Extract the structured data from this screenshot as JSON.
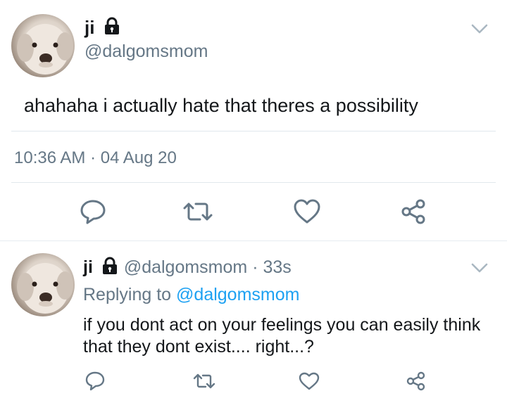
{
  "main_tweet": {
    "display_name": "ji",
    "handle": "@dalgomsmom",
    "text": "ahahaha i actually hate that theres a possibility",
    "time": "10:36 AM",
    "separator": "·",
    "date": "04 Aug 20"
  },
  "reply_tweet": {
    "display_name": "ji",
    "handle": "@dalgomsmom",
    "separator": "·",
    "age": "33s",
    "replying_prefix": "Replying to",
    "replying_to": "@dalgomsmom",
    "text_line1": "if you dont act on your feelings you can easily think",
    "text_line2": "that they dont exist.... right...?"
  },
  "icons": {
    "reply": "speech-bubble-icon",
    "retweet": "retweet-icon",
    "like": "heart-icon",
    "share": "share-icon",
    "menu": "chevron-down-icon",
    "protected": "lock-icon"
  },
  "colors": {
    "text": "#14171a",
    "muted": "#657786",
    "link": "#1da1f2",
    "divider": "#e1e8ed"
  }
}
